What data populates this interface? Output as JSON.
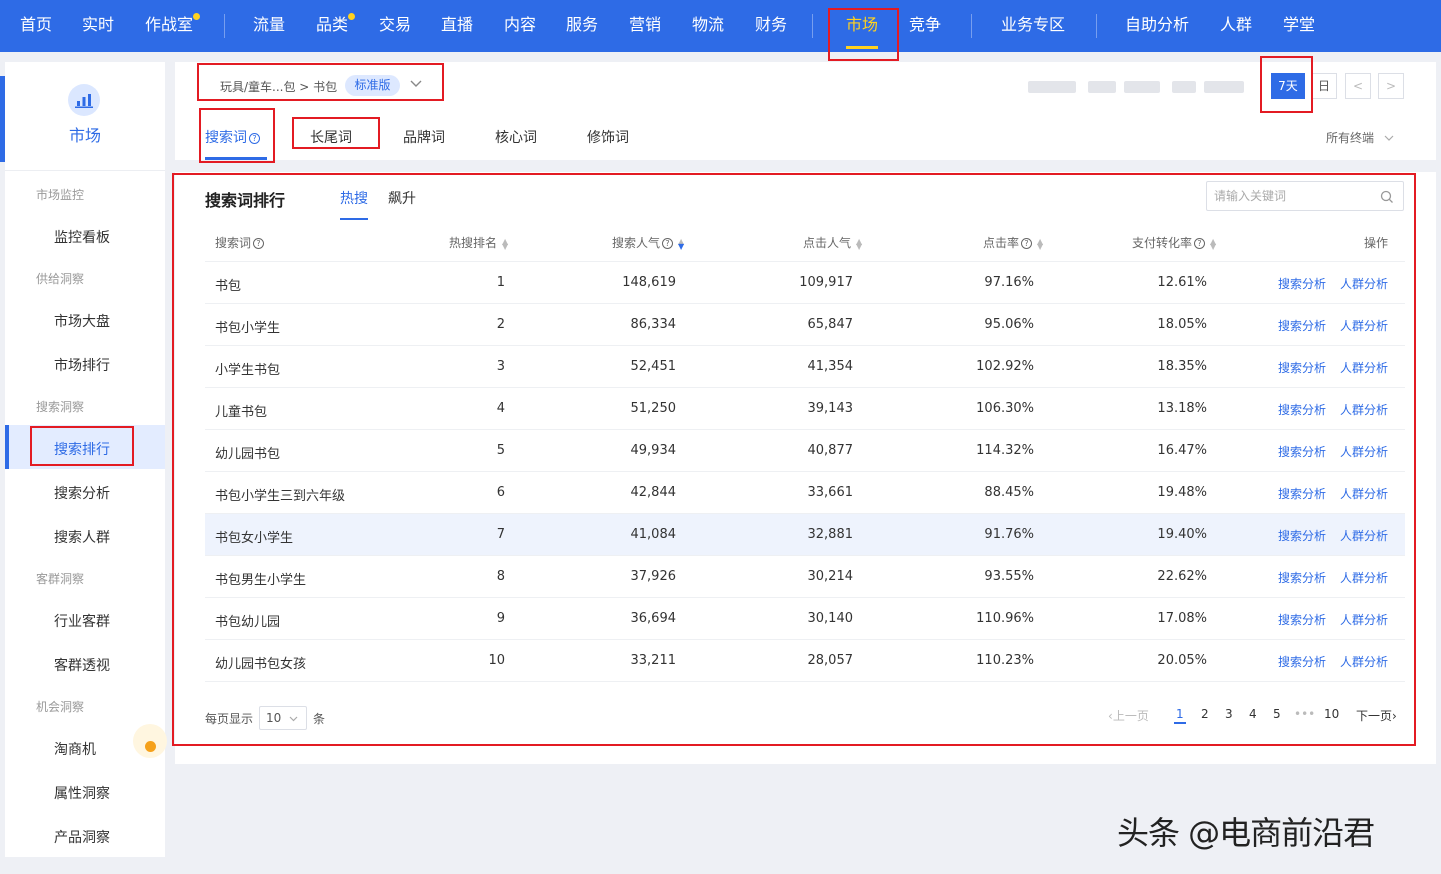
{
  "nav": {
    "items": [
      {
        "label": "首页"
      },
      {
        "label": "实时"
      },
      {
        "label": "作战室",
        "dot": true
      },
      {
        "label": "流量"
      },
      {
        "label": "品类",
        "dot": true
      },
      {
        "label": "交易"
      },
      {
        "label": "直播"
      },
      {
        "label": "内容"
      },
      {
        "label": "服务"
      },
      {
        "label": "营销"
      },
      {
        "label": "物流"
      },
      {
        "label": "财务"
      },
      {
        "label": "市场",
        "active": true
      },
      {
        "label": "竞争"
      },
      {
        "label": "业务专区"
      },
      {
        "label": "自助分析"
      },
      {
        "label": "人群"
      },
      {
        "label": "学堂"
      }
    ]
  },
  "sidebar": {
    "title": "市场",
    "groups": [
      {
        "label": "市场监控",
        "items": [
          "监控看板"
        ]
      },
      {
        "label": "供给洞察",
        "items": [
          "市场大盘",
          "市场排行"
        ]
      },
      {
        "label": "搜索洞察",
        "items": [
          "搜索排行",
          "搜索分析",
          "搜索人群"
        ]
      },
      {
        "label": "客群洞察",
        "items": [
          "行业客群",
          "客群透视"
        ]
      },
      {
        "label": "机会洞察",
        "items": [
          "淘商机",
          "属性洞察",
          "产品洞察"
        ]
      }
    ],
    "active_item": "搜索排行"
  },
  "header": {
    "breadcrumb": "玩具/童车...包 > 书包",
    "edition_badge": "标准版",
    "period_buttons": [
      "7天",
      "日"
    ],
    "active_period": "7天",
    "prev_symbol": "<",
    "next_symbol": ">",
    "tabs": [
      "搜索词",
      "长尾词",
      "品牌词",
      "核心词",
      "修饰词"
    ],
    "active_tab": "搜索词",
    "terminal": "所有终端"
  },
  "ranking": {
    "title": "搜索词排行",
    "subtabs": [
      "热搜",
      "飙升"
    ],
    "active_subtab": "热搜",
    "search_placeholder": "请输入关键词",
    "columns": [
      "搜索词",
      "热搜排名",
      "搜索人气",
      "点击人气",
      "点击率",
      "支付转化率",
      "操作"
    ],
    "rows": [
      {
        "word": "书包",
        "rank": "1",
        "search": "148,619",
        "click": "109,917",
        "ctr": "97.16%",
        "cvr": "12.61%"
      },
      {
        "word": "书包小学生",
        "rank": "2",
        "search": "86,334",
        "click": "65,847",
        "ctr": "95.06%",
        "cvr": "18.05%"
      },
      {
        "word": "小学生书包",
        "rank": "3",
        "search": "52,451",
        "click": "41,354",
        "ctr": "102.92%",
        "cvr": "18.35%"
      },
      {
        "word": "儿童书包",
        "rank": "4",
        "search": "51,250",
        "click": "39,143",
        "ctr": "106.30%",
        "cvr": "13.18%"
      },
      {
        "word": "幼儿园书包",
        "rank": "5",
        "search": "49,934",
        "click": "40,877",
        "ctr": "114.32%",
        "cvr": "16.47%"
      },
      {
        "word": "书包小学生三到六年级",
        "rank": "6",
        "search": "42,844",
        "click": "33,661",
        "ctr": "88.45%",
        "cvr": "19.48%"
      },
      {
        "word": "书包女小学生",
        "rank": "7",
        "search": "41,084",
        "click": "32,881",
        "ctr": "91.76%",
        "cvr": "19.40%"
      },
      {
        "word": "书包男生小学生",
        "rank": "8",
        "search": "37,926",
        "click": "30,214",
        "ctr": "93.55%",
        "cvr": "22.62%"
      },
      {
        "word": "书包幼儿园",
        "rank": "9",
        "search": "36,694",
        "click": "30,140",
        "ctr": "110.96%",
        "cvr": "17.08%"
      },
      {
        "word": "幼儿园书包女孩",
        "rank": "10",
        "search": "33,211",
        "click": "28,057",
        "ctr": "110.23%",
        "cvr": "20.05%"
      }
    ],
    "actions": [
      "搜索分析",
      "人群分析"
    ],
    "highlighted_row": "7"
  },
  "pager": {
    "per_page_label": "每页显示",
    "per_page_value": "10",
    "per_page_unit": "条",
    "prev": "上一页",
    "pages": [
      "1",
      "2",
      "3",
      "4",
      "5"
    ],
    "ellipsis": "•••",
    "last_page": "10",
    "next": "下一页",
    "current": "1"
  },
  "watermark": "头条 @电商前沿君",
  "colors": {
    "primary": "#2e6be6",
    "nav_bg": "#2e6be6",
    "nav_active": "#ffd21f",
    "annotation_red": "#e31b23",
    "orange": "#f5a11b"
  }
}
